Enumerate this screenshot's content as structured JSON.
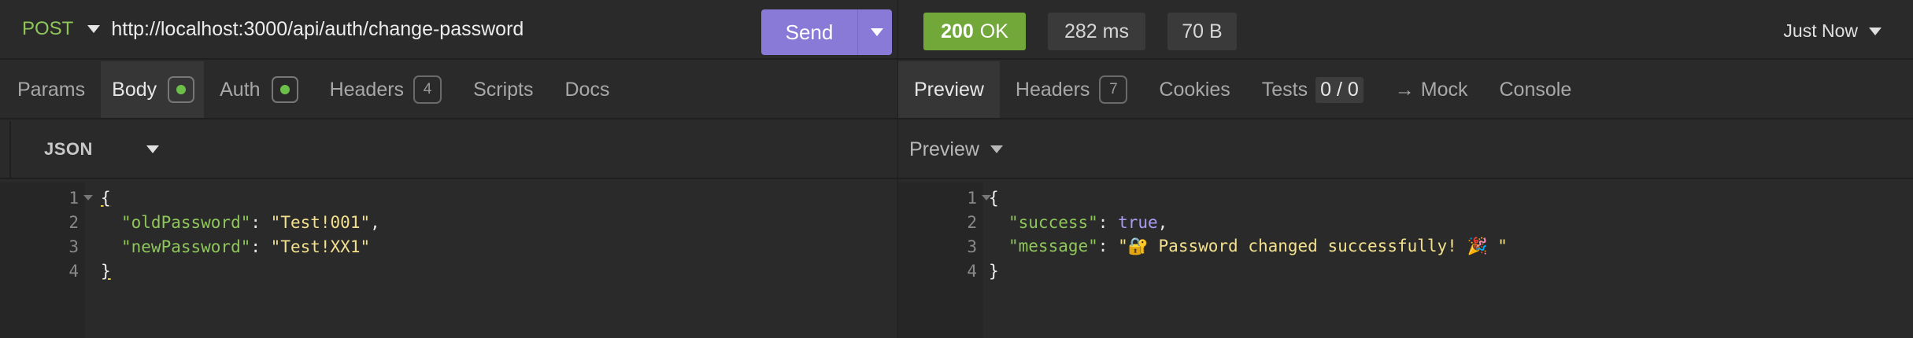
{
  "request": {
    "method": "POST",
    "url": "http://localhost:3000/api/auth/change-password",
    "send_label": "Send",
    "tabs": [
      {
        "label": "Params"
      },
      {
        "label": "Body"
      },
      {
        "label": "Auth"
      },
      {
        "label": "Headers",
        "count": "4"
      },
      {
        "label": "Scripts"
      },
      {
        "label": "Docs"
      }
    ],
    "body_format": "JSON",
    "body_lines": [
      {
        "n": "1",
        "brace": "{"
      },
      {
        "n": "2",
        "key": "\"oldPassword\"",
        "sep": ": ",
        "value": "\"Test!001\"",
        "tail": ","
      },
      {
        "n": "3",
        "key": "\"newPassword\"",
        "sep": ": ",
        "value": "\"Test!XX1\"",
        "tail": ""
      },
      {
        "n": "4",
        "brace": "}"
      }
    ]
  },
  "response": {
    "status_code": "200",
    "status_text": "OK",
    "time": "282 ms",
    "size": "70 B",
    "timestamp": "Just Now",
    "tabs": [
      {
        "label": "Preview"
      },
      {
        "label": "Headers",
        "count": "7"
      },
      {
        "label": "Cookies"
      },
      {
        "label": "Tests",
        "count": "0 / 0"
      },
      {
        "label": "Mock",
        "glyph": "→"
      },
      {
        "label": "Console"
      }
    ],
    "preview_mode": "Preview",
    "body_lines": [
      {
        "n": "1",
        "brace": "{"
      },
      {
        "n": "2",
        "key": "\"success\"",
        "sep": ": ",
        "value": "true",
        "tail": ","
      },
      {
        "n": "3",
        "key": "\"message\"",
        "sep": ": ",
        "value": "\"🔐 Password changed successfully! 🎉 \"",
        "tail": ""
      },
      {
        "n": "4",
        "brace": "}"
      }
    ]
  },
  "colors": {
    "method": "#8ec65a",
    "send_button": "#8a7ad8",
    "status_ok": "#72a839",
    "json_key": "#8ec65a",
    "json_string": "#f2e08c",
    "json_boolean": "#a79bf2",
    "active_dot": "#6cc04a"
  },
  "icons": {
    "method_dropdown": "chevron-down-icon",
    "send_dropdown": "chevron-down-icon",
    "active_indicator": "dot-icon",
    "mock_arrow": "arrow-right-icon",
    "fold": "fold-caret-icon"
  }
}
